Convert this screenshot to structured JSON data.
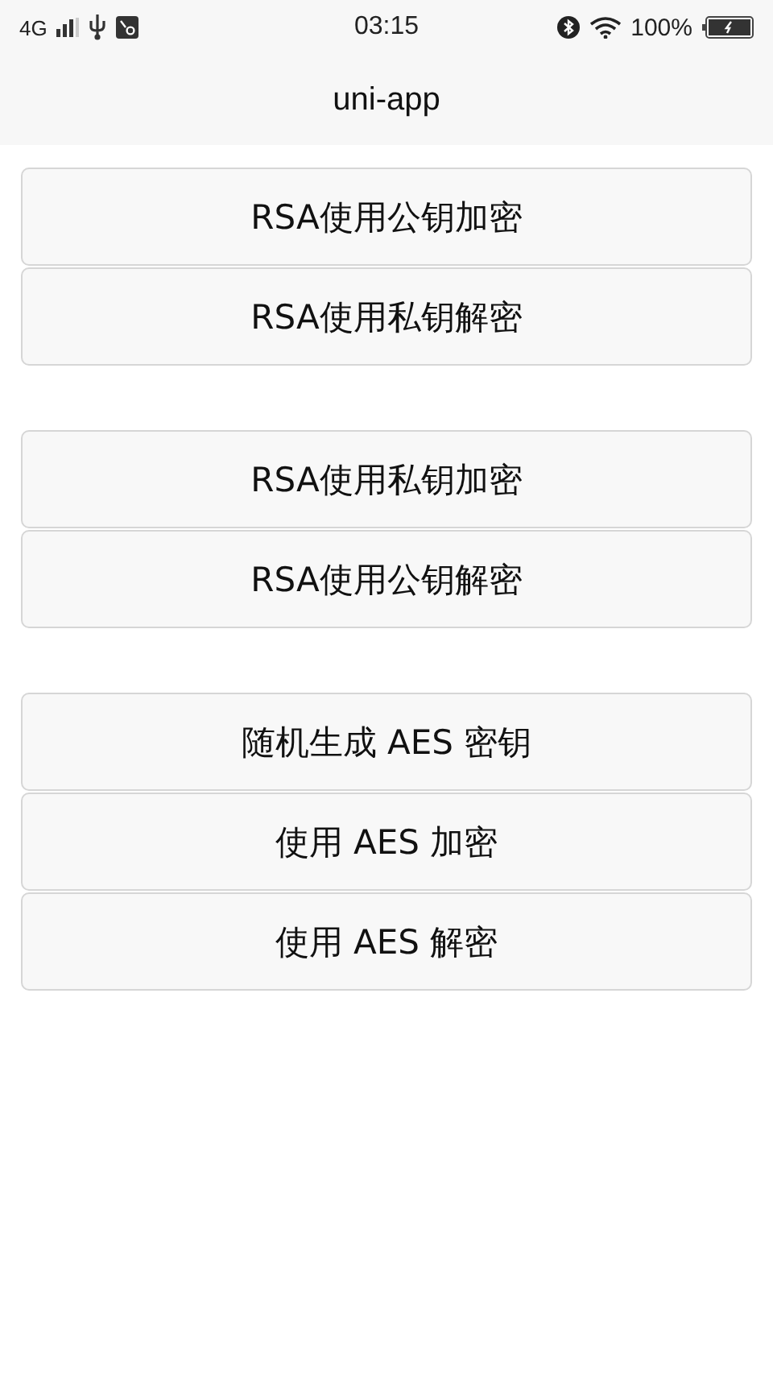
{
  "status_bar": {
    "network": "4G",
    "time": "03:15",
    "battery": "100%"
  },
  "nav_bar": {
    "title": "uni-app"
  },
  "button_groups": [
    {
      "buttons": [
        "RSA使用公钥加密",
        "RSA使用私钥解密"
      ]
    },
    {
      "buttons": [
        "RSA使用私钥加密",
        "RSA使用公钥解密"
      ]
    },
    {
      "buttons": [
        "随机生成 AES 密钥",
        "使用 AES 加密",
        "使用 AES 解密"
      ]
    }
  ]
}
